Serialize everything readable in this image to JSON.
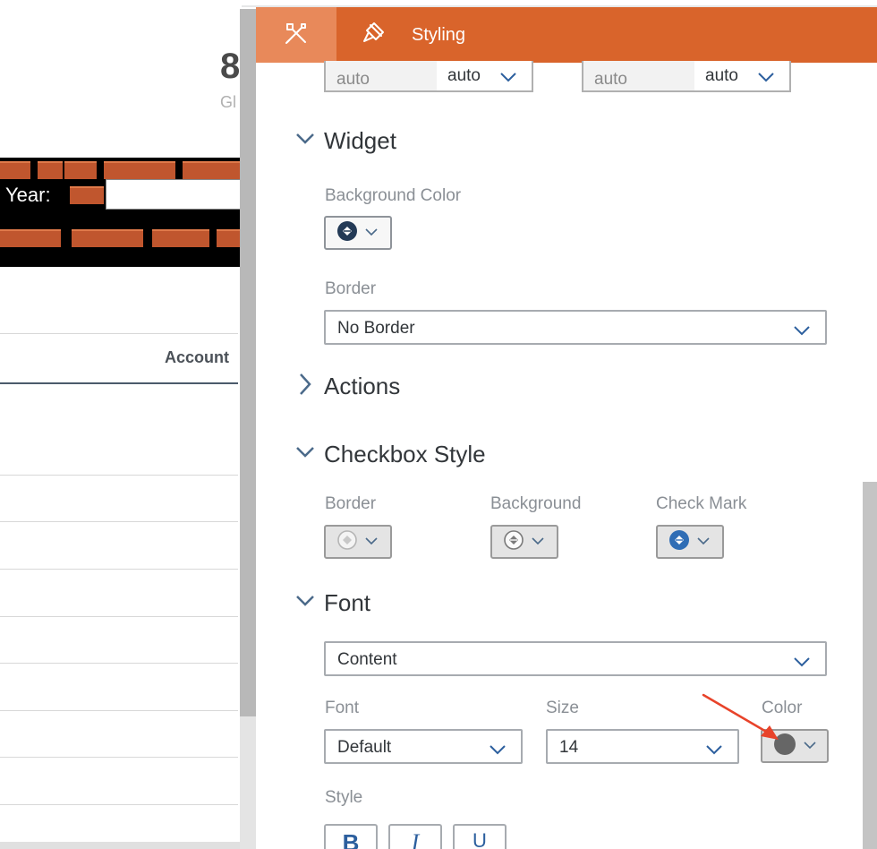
{
  "background": {
    "kpi_value": "8",
    "kpi_subtitle": "Gl",
    "year_label": "Year:",
    "account_header": "Account"
  },
  "panel": {
    "tabs": {
      "builder_icon": "tools-icon",
      "styling_icon": "paint-brush-icon",
      "styling_label": "Styling"
    },
    "size": {
      "width_value": "auto",
      "width_unit": "auto",
      "height_value": "auto",
      "height_unit": "auto"
    },
    "widget": {
      "title": "Widget",
      "background_color_label": "Background Color",
      "border_label": "Border",
      "border_value": "No Border"
    },
    "actions": {
      "title": "Actions"
    },
    "checkbox_style": {
      "title": "Checkbox Style",
      "border_label": "Border",
      "background_label": "Background",
      "check_mark_label": "Check Mark"
    },
    "font": {
      "title": "Font",
      "target_value": "Content",
      "font_label": "Font",
      "font_value": "Default",
      "size_label": "Size",
      "size_value": "14",
      "color_label": "Color",
      "style_label": "Style",
      "bold_label": "B",
      "italic_label": "I",
      "underline_label": "U"
    }
  },
  "colors": {
    "header_orange": "#d9642b",
    "tab_active": "#e8895a",
    "accent_blue": "#2c5f9e",
    "annotation_red": "#e8432a",
    "font_color_swatch": "#666666"
  }
}
